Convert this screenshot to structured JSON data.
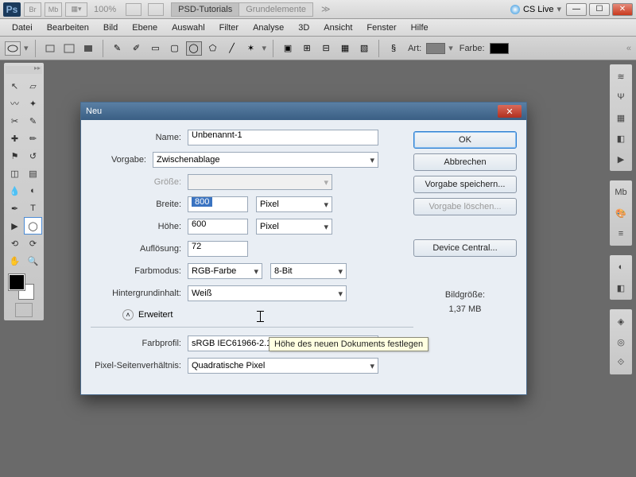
{
  "header": {
    "ps": "Ps",
    "zoom": "100%",
    "tabs": [
      "PSD-Tutorials",
      "Grundelemente"
    ],
    "active_tab": 0,
    "cs_live": "CS Live"
  },
  "menu": [
    "Datei",
    "Bearbeiten",
    "Bild",
    "Ebene",
    "Auswahl",
    "Filter",
    "Analyse",
    "3D",
    "Ansicht",
    "Fenster",
    "Hilfe"
  ],
  "options": {
    "art_label": "Art:",
    "farbe_label": "Farbe:",
    "farbe_hex": "#000000",
    "art_swatch": "#808080"
  },
  "dialog": {
    "title": "Neu",
    "name_label": "Name:",
    "name_value": "Unbenannt-1",
    "vorgabe_label": "Vorgabe:",
    "vorgabe_value": "Zwischenablage",
    "groesse_label": "Größe:",
    "breite_label": "Breite:",
    "breite_value": "800",
    "hoehe_label": "Höhe:",
    "hoehe_value": "600",
    "unit_px": "Pixel",
    "aufloesung_label": "Auflösung:",
    "aufloesung_value": "72",
    "farbmodus_label": "Farbmodus:",
    "farbmodus_value": "RGB-Farbe",
    "bit_value": "8-Bit",
    "bg_label": "Hintergrundinhalt:",
    "bg_value": "Weiß",
    "erweitert_label": "Erweitert",
    "farbprofil_label": "Farbprofil:",
    "farbprofil_value": "sRGB IEC61966-2.1",
    "pixelsv_label": "Pixel-Seitenverhältnis:",
    "pixelsv_value": "Quadratische Pixel",
    "btn_ok": "OK",
    "btn_cancel": "Abbrechen",
    "btn_save_preset": "Vorgabe speichern...",
    "btn_del_preset": "Vorgabe löschen...",
    "btn_device_central": "Device Central...",
    "size_heading": "Bildgröße:",
    "size_value": "1,37 MB",
    "tooltip": "Höhe des neuen Dokuments festlegen"
  }
}
